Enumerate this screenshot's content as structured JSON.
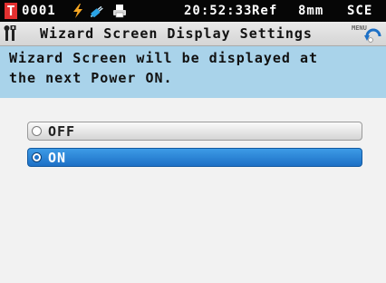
{
  "status_bar": {
    "target_badge": "T",
    "target_id": "0001",
    "time": "20:52:33",
    "ref": "Ref",
    "measurement_area": "8mm",
    "component_mode": "SCE",
    "icons": [
      "lightning-icon",
      "usb-plug-icon",
      "printer-icon"
    ]
  },
  "title_bar": {
    "title": "Wizard Screen Display Settings",
    "menu_label": "MENU",
    "icons": [
      "settings-tools-icon",
      "menu-back-arrow-icon"
    ]
  },
  "message": "Wizard Screen will be displayed at\nthe next Power ON.",
  "options": [
    {
      "label": "OFF",
      "selected": false
    },
    {
      "label": "ON",
      "selected": true
    }
  ],
  "colors": {
    "status_bar_bg": "#060606",
    "target_badge": "#e23030",
    "message_bg": "#a9d3ea",
    "selected_option": "#1d70c6",
    "lightning": "#f5a623"
  }
}
